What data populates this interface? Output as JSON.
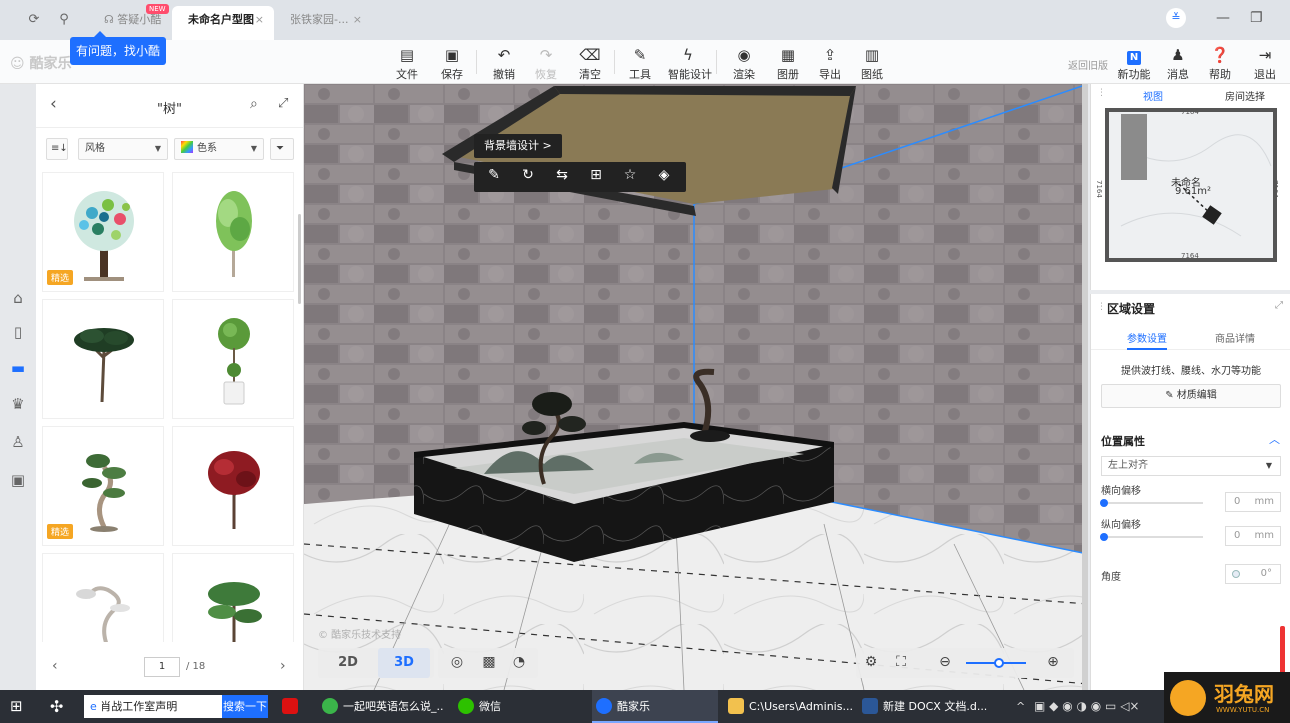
{
  "browser": {
    "tabs": [
      {
        "label": "答疑小酷",
        "badge": "NEW"
      },
      {
        "label": "未命名户型图"
      },
      {
        "label": "张铁家园-..."
      }
    ],
    "close_glyph": "×",
    "tooltip": "有问题，找小酷"
  },
  "app": {
    "logo": "酷家乐",
    "toolbar": [
      {
        "label": "文件",
        "icon": "file-icon"
      },
      {
        "label": "保存",
        "icon": "save-icon"
      },
      {
        "label": "撤销",
        "icon": "undo-icon"
      },
      {
        "label": "恢复",
        "icon": "redo-icon",
        "disabled": true
      },
      {
        "label": "清空",
        "icon": "eraser-icon"
      },
      {
        "label": "工具",
        "icon": "wrench-icon"
      },
      {
        "label": "智能设计",
        "icon": "lightning-icon"
      },
      {
        "label": "渲染",
        "icon": "camera-icon"
      },
      {
        "label": "图册",
        "icon": "album-icon"
      },
      {
        "label": "导出",
        "icon": "export-icon"
      },
      {
        "label": "图纸",
        "icon": "drawing-icon"
      }
    ],
    "back_old": "返回旧版",
    "right_tools": [
      {
        "label": "新功能",
        "icon": "new-feature-icon",
        "glyph": "N"
      },
      {
        "label": "消息",
        "icon": "bell-icon"
      },
      {
        "label": "帮助",
        "icon": "help-icon"
      },
      {
        "label": "退出",
        "icon": "exit-icon"
      }
    ]
  },
  "left_panel": {
    "title": "\"树\"",
    "filters": {
      "style": "风格",
      "color": "色系"
    },
    "items": [
      {
        "name": "hand-tree",
        "tag": "精选"
      },
      {
        "name": "green-birch",
        "tag": ""
      },
      {
        "name": "umbrella-pine",
        "tag": ""
      },
      {
        "name": "topiary-pot",
        "tag": ""
      },
      {
        "name": "bonsai-pine",
        "tag": "精选"
      },
      {
        "name": "red-maple",
        "tag": ""
      },
      {
        "name": "white-bonsai",
        "tag": ""
      },
      {
        "name": "cedar",
        "tag": ""
      }
    ],
    "pager": {
      "current": "1",
      "total": "/ 18"
    }
  },
  "viewport": {
    "context_title": "背景墙设计",
    "context_arrow": ">",
    "watermark": "© 酷家乐技术支持",
    "view_2d": "2D",
    "view_3d": "3D",
    "active_view": "3D"
  },
  "minimap": {
    "tabs": [
      "视图",
      "房间选择"
    ],
    "room_name": "未命名",
    "room_area": "9.61m²",
    "dim_top": "7164",
    "dim_bottom": "7164",
    "dim_left": "7164",
    "dim_right": "7164"
  },
  "properties": {
    "title": "区域设置",
    "tabs": [
      "参数设置",
      "商品详情"
    ],
    "description": "提供波打线、腰线、水刀等功能",
    "material_button": "材质编辑",
    "section": "位置属性",
    "align": "左上对齐",
    "h_offset_label": "横向偏移",
    "h_offset_value": "0",
    "v_offset_label": "纵向偏移",
    "v_offset_value": "0",
    "unit": "mm",
    "angle_label": "角度",
    "angle_value": "0°"
  },
  "taskbar": {
    "search_value": "肖战工作室声明",
    "search_button": "搜索一下",
    "items": [
      {
        "label": "一起吧英语怎么说_..."
      },
      {
        "label": "微信"
      },
      {
        "label": "酷家乐"
      },
      {
        "label": "C:\\Users\\Adminis..."
      },
      {
        "label": "新建 DOCX 文档.d..."
      }
    ]
  },
  "watermark_site": {
    "name": "羽兔网",
    "url": "WWW.YUTU.CN"
  }
}
